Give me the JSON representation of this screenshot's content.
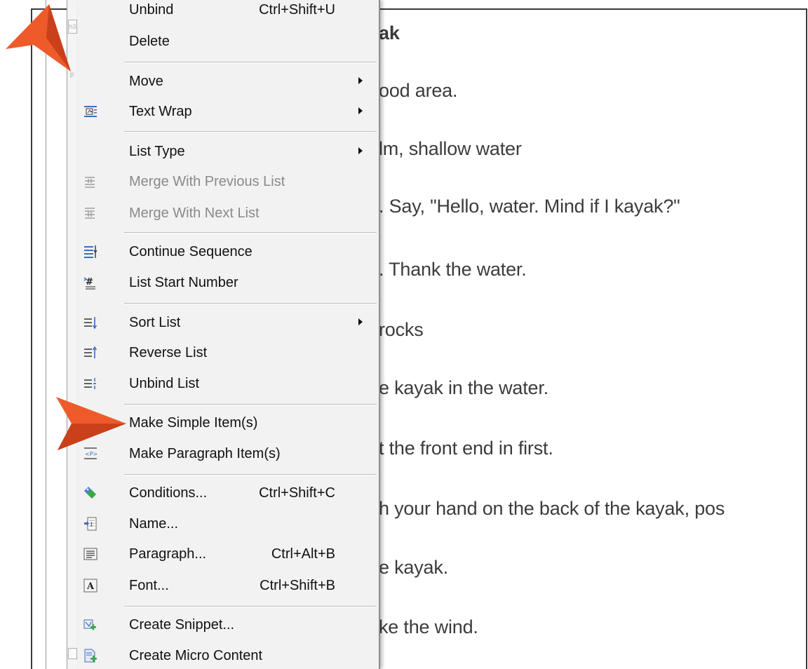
{
  "document": {
    "lines": [
      {
        "text": "ak"
      },
      {
        "text": "ood area."
      },
      {
        "text": "lm, shallow water"
      },
      {
        "text": ".   Say, \"Hello, water. Mind if I kayak?\""
      },
      {
        "text": ".   Thank the water."
      },
      {
        "text": "rocks"
      },
      {
        "text": "e kayak in the water."
      },
      {
        "text": "t the front end in first."
      },
      {
        "text": "h your hand on the back of the kayak, pos"
      },
      {
        "text": "e kayak."
      },
      {
        "text": "ke the wind."
      }
    ],
    "gutter_tags": {
      "tag1": "h3",
      "tag2": "p"
    }
  },
  "context_menu": {
    "items": [
      {
        "label": "Unbind",
        "shortcut": "Ctrl+Shift+U",
        "icon": "none",
        "enabled": true
      },
      {
        "label": "Delete",
        "icon": "none",
        "enabled": true
      },
      {
        "label": "Move",
        "icon": "none",
        "submenu": true,
        "enabled": true
      },
      {
        "label": "Text Wrap",
        "icon": "text-wrap-icon",
        "submenu": true,
        "enabled": true
      },
      {
        "label": "List Type",
        "icon": "none",
        "submenu": true,
        "enabled": true
      },
      {
        "label": "Merge With Previous List",
        "icon": "merge-previous-list-icon",
        "enabled": false
      },
      {
        "label": "Merge With Next List",
        "icon": "merge-next-list-icon",
        "enabled": false
      },
      {
        "label": "Continue Sequence",
        "icon": "continue-sequence-icon",
        "enabled": true
      },
      {
        "label": "List Start Number",
        "icon": "list-start-number-icon",
        "enabled": true
      },
      {
        "label": "Sort List",
        "icon": "sort-list-icon",
        "submenu": true,
        "enabled": true
      },
      {
        "label": "Reverse List",
        "icon": "reverse-list-icon",
        "enabled": true
      },
      {
        "label": "Unbind List",
        "icon": "unbind-list-icon",
        "enabled": true
      },
      {
        "label": "Make Simple Item(s)",
        "icon": "make-simple-item-icon",
        "enabled": true
      },
      {
        "label": "Make Paragraph Item(s)",
        "icon": "make-paragraph-item-icon",
        "enabled": true
      },
      {
        "label": "Conditions...",
        "shortcut": "Ctrl+Shift+C",
        "icon": "conditions-tag-icon",
        "enabled": true
      },
      {
        "label": "Name...",
        "icon": "name-icon",
        "enabled": true
      },
      {
        "label": "Paragraph...",
        "shortcut": "Ctrl+Alt+B",
        "icon": "paragraph-icon",
        "enabled": true
      },
      {
        "label": "Font...",
        "shortcut": "Ctrl+Shift+B",
        "icon": "font-icon",
        "enabled": true
      },
      {
        "label": "Create Snippet...",
        "icon": "create-snippet-icon",
        "enabled": true
      },
      {
        "label": "Create Micro Content",
        "icon": "create-micro-content-icon",
        "enabled": true
      }
    ]
  },
  "colors": {
    "callout_orange": "#ee5a2a",
    "menu_background": "#f2f2f2",
    "disabled_text": "#8a8a8a",
    "icon_blue": "#3a6fc0",
    "icon_green": "#3aa845"
  }
}
